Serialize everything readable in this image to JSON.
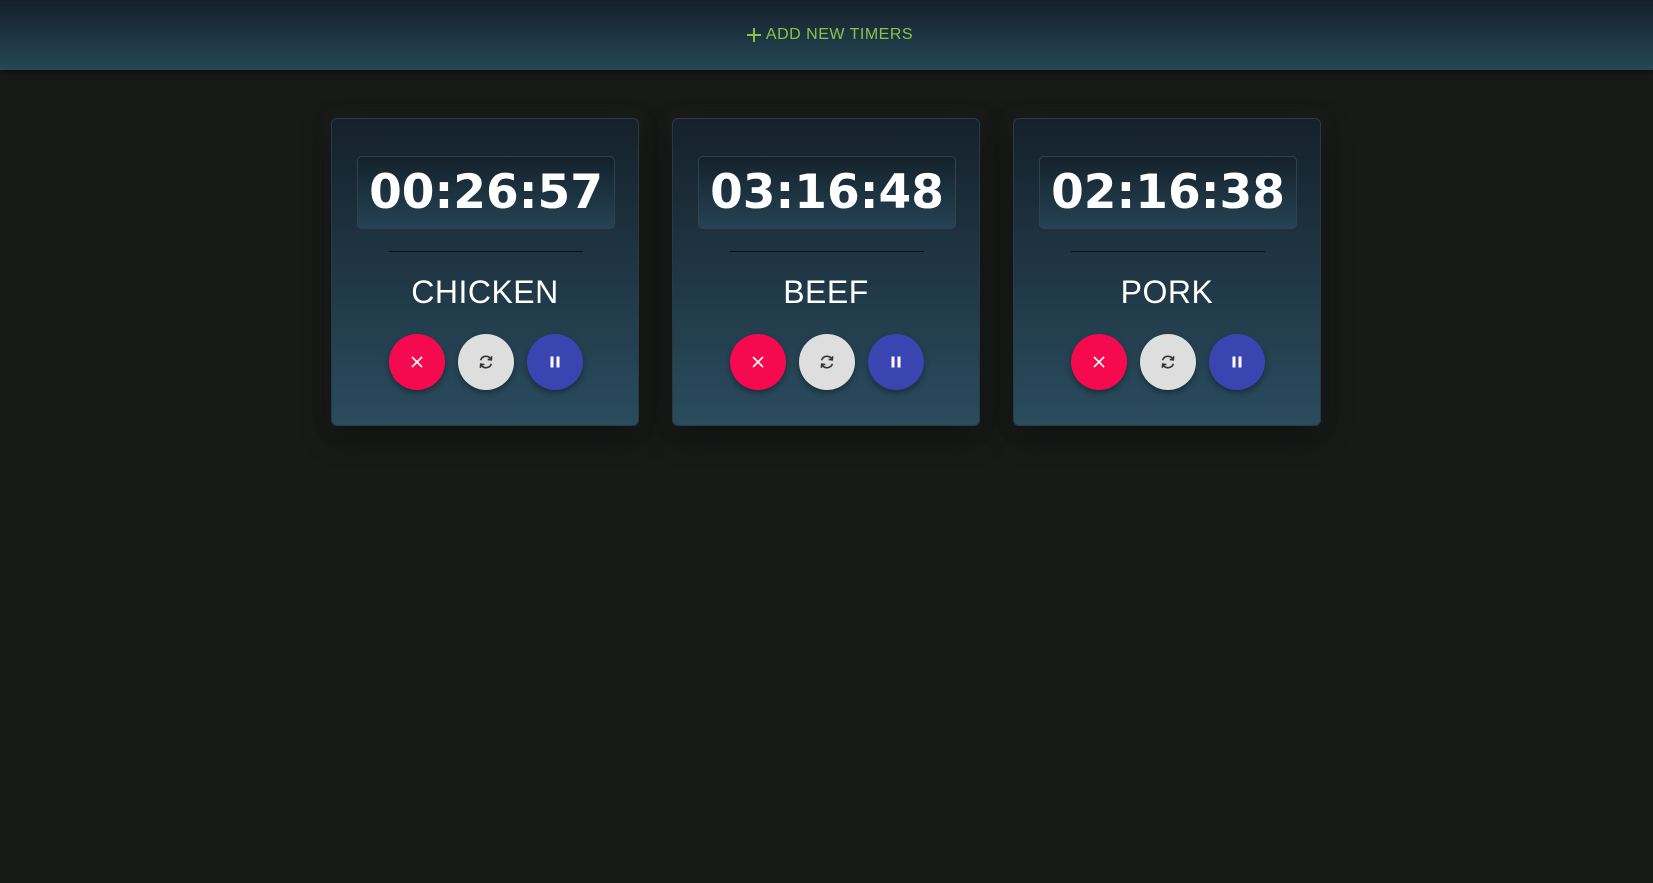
{
  "header": {
    "add_label": "ADD NEW TIMERS",
    "add_icon": "plus-icon",
    "accent": "#8bc34a"
  },
  "timers": [
    {
      "time": "00:26:57",
      "name": "CHICKEN"
    },
    {
      "time": "03:16:48",
      "name": "BEEF"
    },
    {
      "time": "02:16:38",
      "name": "PORK"
    }
  ],
  "colors": {
    "delete": "#f5094f",
    "reset": "#dedede",
    "pause": "#3a45b2",
    "background": "#181a18"
  },
  "icons": {
    "delete": "close-icon",
    "reset": "refresh-icon",
    "pause": "pause-icon"
  }
}
